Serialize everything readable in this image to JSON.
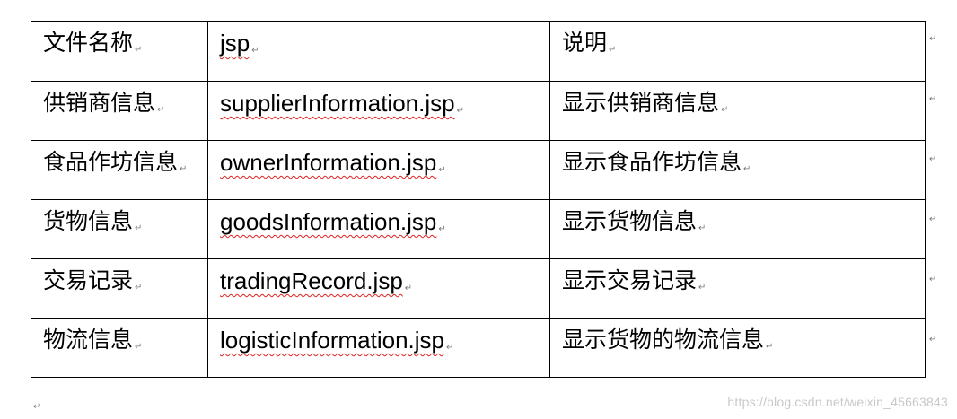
{
  "table": {
    "rows": [
      [
        "文件名称",
        "jsp",
        "说明"
      ],
      [
        "供销商信息",
        "supplierInformation.jsp",
        "显示供销商信息"
      ],
      [
        "食品作坊信息",
        "ownerInformation.jsp",
        "显示食品作坊信息"
      ],
      [
        "货物信息",
        "goodsInformation.jsp",
        "显示货物信息"
      ],
      [
        "交易记录",
        "tradingRecord.jsp",
        "显示交易记录"
      ],
      [
        "物流信息",
        "logisticInformation.jsp",
        "显示货物的物流信息"
      ]
    ]
  },
  "marks": {
    "paragraph_mark": "↵"
  },
  "watermark": "https://blog.csdn.net/weixin_45663843",
  "colors": {
    "text": "#000000",
    "border": "#000000",
    "spellcheck_underline": "#e02020",
    "formatting_mark": "#7a7a7a",
    "watermark": "#c9c9c9"
  }
}
